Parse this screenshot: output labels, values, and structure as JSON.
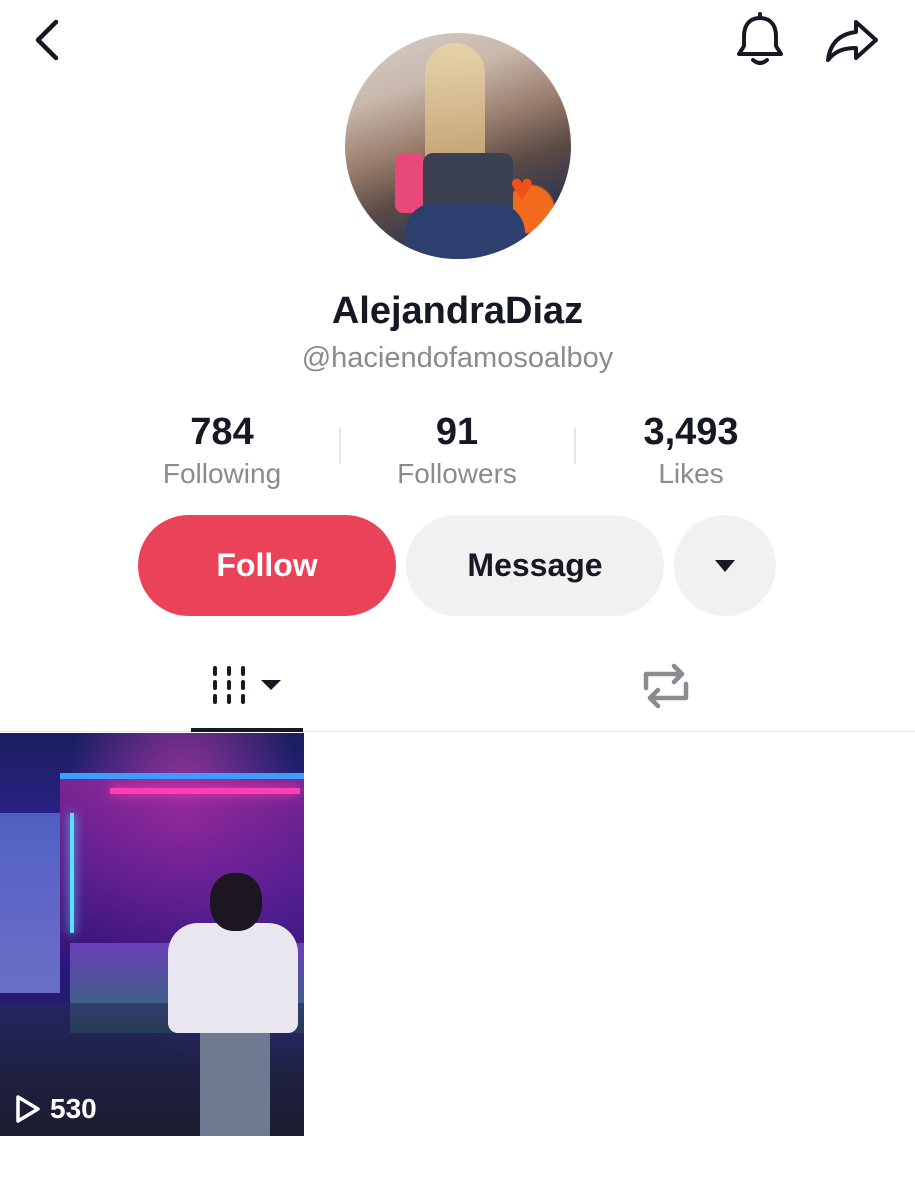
{
  "profile": {
    "display_name": "AlejandraDiaz",
    "handle": "@haciendofamosoalboy"
  },
  "stats": {
    "following": {
      "value": "784",
      "label": "Following"
    },
    "followers": {
      "value": "91",
      "label": "Followers"
    },
    "likes": {
      "value": "3,493",
      "label": "Likes"
    }
  },
  "actions": {
    "follow_label": "Follow",
    "message_label": "Message"
  },
  "videos": [
    {
      "views": "530"
    }
  ],
  "colors": {
    "follow_button": "#ea4359",
    "secondary_button": "#f1f1f2",
    "muted_text": "#8a8b91",
    "primary_text": "#161823"
  },
  "icons": {
    "back": "chevron-left-icon",
    "notifications": "bell-icon",
    "share": "share-arrow-icon",
    "more": "caret-down-icon",
    "videos_tab": "grid-bars-icon",
    "reposts_tab": "repost-icon",
    "views": "play-outline-icon"
  }
}
